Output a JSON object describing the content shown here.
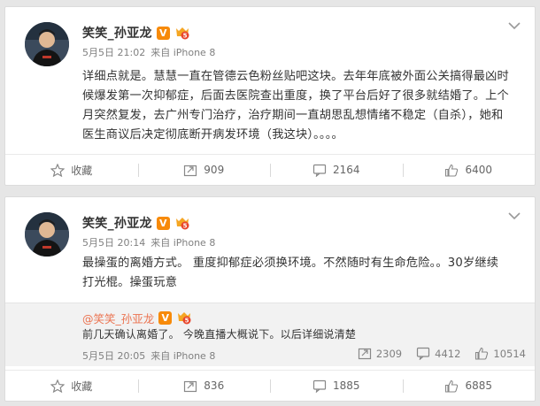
{
  "colors": {
    "vip_badge": "#f78a09",
    "retweet_name": "#eb7350",
    "meta_gray": "#808080",
    "page_bg": "#e6e6e6"
  },
  "posts": [
    {
      "author": "笑笑_孙亚龙",
      "vip_badge": "V",
      "level_badge": "5",
      "date": "5月5日 21:02",
      "source": "来自 iPhone 8",
      "text": "详细点就是。慧慧一直在管德云色粉丝贴吧这块。去年年底被外面公关搞得最凶时候爆发第一次抑郁症，后面去医院查出重度，换了平台后好了很多就结婚了。上个月突然复发，去广州专门治疗，治疗期间一直胡思乱想情绪不稳定（自杀），她和医生商议后决定彻底断开病发环境（我这块）。。。。",
      "actions": {
        "favorite": "收藏",
        "repost": "909",
        "comment": "2164",
        "like": "6400"
      }
    },
    {
      "author": "笑笑_孙亚龙",
      "vip_badge": "V",
      "level_badge": "5",
      "date": "5月5日 20:14",
      "source": "来自 iPhone 8",
      "text": "最操蛋的离婚方式。 重度抑郁症必须换环境。不然随时有生命危险。。30岁继续打光棍。操蛋玩意",
      "retweet": {
        "author": "@笑笑_孙亚龙",
        "vip_badge": "V",
        "level_badge": "5",
        "text": "前几天确认离婚了。 今晚直播大概说下。以后详细说清楚",
        "date": "5月5日 20:05",
        "source": "来自 iPhone 8",
        "repost": "2309",
        "comment": "4412",
        "like": "10514"
      },
      "actions": {
        "favorite": "收藏",
        "repost": "836",
        "comment": "1885",
        "like": "6885"
      }
    }
  ]
}
